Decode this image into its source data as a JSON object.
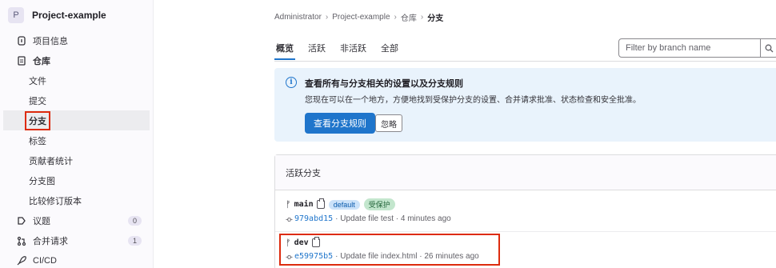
{
  "sidebar": {
    "project_avatar": "P",
    "project_name": "Project-example",
    "items": [
      {
        "label": "项目信息",
        "icon": "info-icon"
      },
      {
        "label": "仓库",
        "icon": "repository-icon"
      },
      {
        "label": "文件"
      },
      {
        "label": "提交"
      },
      {
        "label": "分支"
      },
      {
        "label": "标签"
      },
      {
        "label": "贡献者统计"
      },
      {
        "label": "分支图"
      },
      {
        "label": "比较修订版本"
      },
      {
        "label": "议题",
        "icon": "issues-icon",
        "count": "0"
      },
      {
        "label": "合并请求",
        "icon": "merge-request-icon",
        "count": "1"
      },
      {
        "label": "CI/CD",
        "icon": "rocket-icon"
      }
    ]
  },
  "breadcrumb": {
    "items": [
      "Administrator",
      "Project-example",
      "仓库",
      "分支"
    ],
    "separator": "›"
  },
  "tabs": [
    "概览",
    "活跃",
    "非活跃",
    "全部"
  ],
  "filter": {
    "placeholder": "Filter by branch name",
    "value": ""
  },
  "alert": {
    "title": "查看所有与分支相关的设置以及分支规则",
    "body": "您现在可以在一个地方，方便地找到受保护分支的设置、合并请求批准、状态检查和安全批准。",
    "primary_button": "查看分支规则",
    "secondary_button": "忽略"
  },
  "active_branches": {
    "header": "活跃分支",
    "branches": [
      {
        "name": "main",
        "badges": [
          "default",
          "受保护"
        ],
        "sha": "979abd15",
        "message": "· Update file test · 4 minutes ago"
      },
      {
        "name": "dev",
        "badges": [],
        "sha": "e59975b5",
        "message": "· Update file index.html · 26 minutes ago"
      }
    ]
  },
  "colors": {
    "accent": "#1f75cb",
    "highlight": "#dd2b0e",
    "alert_bg": "#e9f3fc"
  }
}
